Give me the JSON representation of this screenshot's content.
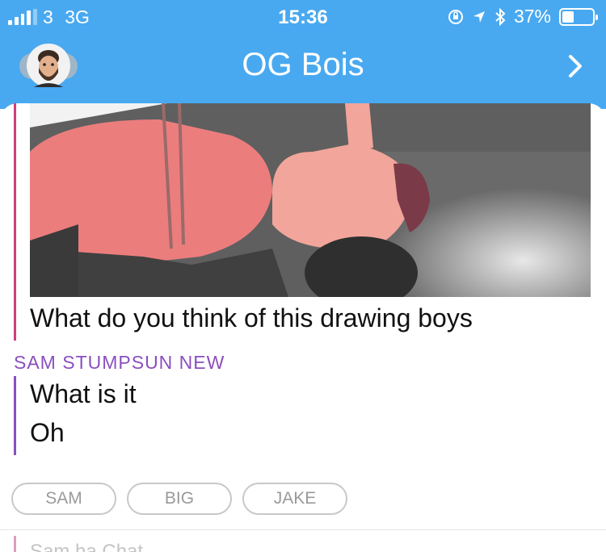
{
  "status_bar": {
    "carrier": "3",
    "network": "3G",
    "time": "15:36",
    "battery": "37%",
    "battery_level": 0.37
  },
  "header": {
    "title": "OG Bois",
    "avatar_icon": "group-bitmoji-avatar-icon",
    "chevron_icon": "chevron-right-icon",
    "bg_color": "#49a9f0"
  },
  "messages": [
    {
      "text": "What do you think of this drawing boys",
      "bar_color": "#d03e7e"
    }
  ],
  "sender": {
    "name": "SAM STUMPSUN NEW",
    "color": "#8a4fbf",
    "lines": [
      "What is it",
      "Oh"
    ]
  },
  "chips": [
    "SAM",
    "BIG",
    "JAKE"
  ],
  "next_preview": "Sam  ha  Chat"
}
